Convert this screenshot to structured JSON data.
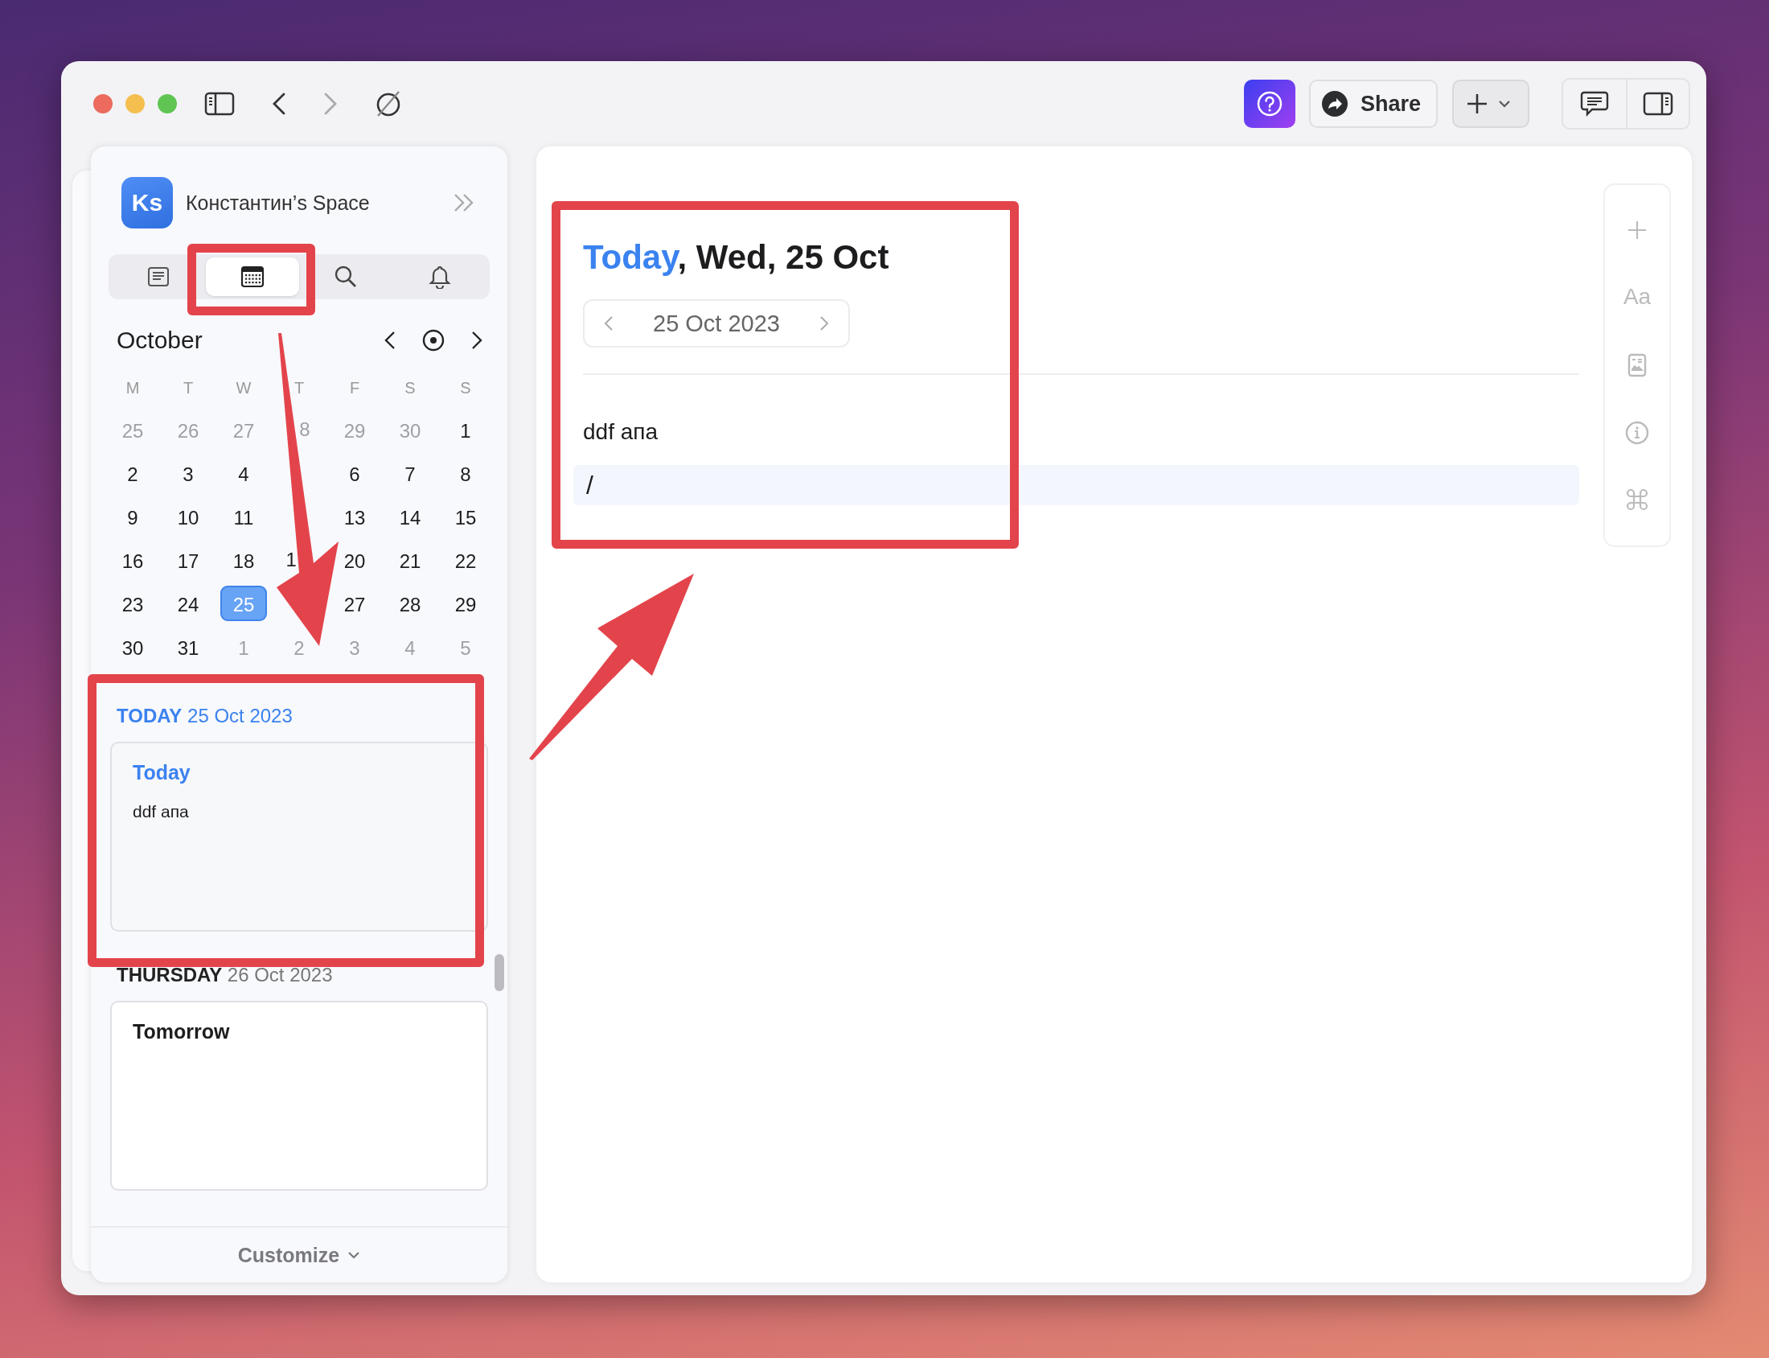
{
  "toolbar": {
    "share_label": "Share"
  },
  "sidebar": {
    "space": {
      "initials": "Ks",
      "name": "Константин’s Space"
    },
    "tabs": [
      {
        "kind": "notes",
        "selected": false
      },
      {
        "kind": "calendar",
        "selected": true
      },
      {
        "kind": "search",
        "selected": false
      },
      {
        "kind": "notifications",
        "selected": false
      }
    ],
    "calendar": {
      "month": "October",
      "weekdays": [
        "M",
        "T",
        "W",
        "T",
        "F",
        "S",
        "S"
      ],
      "days": [
        {
          "label": "25",
          "outside": true,
          "selected": false,
          "outlined": false
        },
        {
          "label": "26",
          "outside": true,
          "selected": false,
          "outlined": false
        },
        {
          "label": "27",
          "outside": true,
          "selected": false,
          "outlined": false
        },
        {
          "label": "8",
          "kind": "tail",
          "outside": true
        },
        {
          "label": "29",
          "outside": true,
          "selected": false,
          "outlined": false
        },
        {
          "label": "30",
          "outside": true,
          "selected": false,
          "outlined": false
        },
        {
          "label": "1",
          "outside": false,
          "selected": false,
          "outlined": false
        },
        {
          "label": "2",
          "outside": false,
          "selected": false,
          "outlined": false
        },
        {
          "label": "3",
          "outside": false,
          "selected": false,
          "outlined": false
        },
        {
          "label": "4",
          "outside": false,
          "selected": false,
          "outlined": false
        },
        {
          "kind": "covered"
        },
        {
          "label": "6",
          "outside": false,
          "selected": false,
          "outlined": false
        },
        {
          "label": "7",
          "outside": false,
          "selected": false,
          "outlined": false
        },
        {
          "label": "8",
          "outside": false,
          "selected": false,
          "outlined": false
        },
        {
          "label": "9",
          "outside": false,
          "selected": false,
          "outlined": false
        },
        {
          "label": "10",
          "outside": false,
          "selected": false,
          "outlined": false
        },
        {
          "label": "11",
          "outside": false,
          "selected": false,
          "outlined": false
        },
        {
          "kind": "covered"
        },
        {
          "label": "13",
          "outside": false,
          "selected": false,
          "outlined": false
        },
        {
          "label": "14",
          "outside": false,
          "selected": false,
          "outlined": false
        },
        {
          "label": "15",
          "outside": false,
          "selected": false,
          "outlined": false
        },
        {
          "label": "16",
          "outside": false,
          "selected": false,
          "outlined": false
        },
        {
          "label": "17",
          "outside": false,
          "selected": false,
          "outlined": false
        },
        {
          "label": "18",
          "outside": false,
          "selected": false,
          "outlined": false
        },
        {
          "label": "1",
          "kind": "head",
          "outside": false
        },
        {
          "label": "20",
          "outside": false,
          "selected": false,
          "outlined": false
        },
        {
          "label": "21",
          "outside": false,
          "selected": false,
          "outlined": false
        },
        {
          "label": "22",
          "outside": false,
          "selected": false,
          "outlined": false
        },
        {
          "label": "23",
          "outside": false,
          "selected": false,
          "outlined": false
        },
        {
          "label": "24",
          "outside": false,
          "selected": false,
          "outlined": false
        },
        {
          "label": "25",
          "outside": false,
          "selected": true,
          "outlined": false
        },
        {
          "kind": "covered"
        },
        {
          "label": "27",
          "outside": false,
          "selected": false,
          "outlined": false
        },
        {
          "label": "28",
          "outside": false,
          "selected": false,
          "outlined": false
        },
        {
          "label": "29",
          "outside": false,
          "selected": false,
          "outlined": false
        },
        {
          "label": "30",
          "outside": false,
          "selected": false,
          "outlined": false
        },
        {
          "label": "31",
          "outside": false,
          "selected": false,
          "outlined": false
        },
        {
          "label": "1",
          "outside": true,
          "selected": false,
          "outlined": false
        },
        {
          "label": "2",
          "outside": true,
          "selected": false,
          "outlined": false
        },
        {
          "label": "3",
          "outside": true,
          "selected": false,
          "outlined": false
        },
        {
          "label": "4",
          "outside": true,
          "selected": false,
          "outlined": false
        },
        {
          "label": "5",
          "outside": true,
          "selected": false,
          "outlined": false
        }
      ]
    },
    "days": [
      {
        "weekday": "TODAY",
        "date": "25 Oct 2023",
        "today": true,
        "card_title": "Today",
        "card_lines": [
          "ddf апа"
        ]
      },
      {
        "weekday": "THURSDAY",
        "date": "26 Oct 2023",
        "today": false,
        "card_title": "Tomorrow"
      }
    ],
    "footer": {
      "label": "Customize"
    }
  },
  "editor": {
    "title_highlight": "Today",
    "title_rest": ", Wed, 25 Oct",
    "date": "25 Oct 2023",
    "lines": [
      {
        "text": "ddf апа",
        "selected": false
      },
      {
        "text": "/",
        "selected": true
      }
    ],
    "side_tools": [
      {
        "kind": "add"
      },
      {
        "kind": "text",
        "label": "Aa"
      },
      {
        "kind": "template"
      },
      {
        "kind": "info"
      },
      {
        "kind": "command"
      }
    ]
  }
}
